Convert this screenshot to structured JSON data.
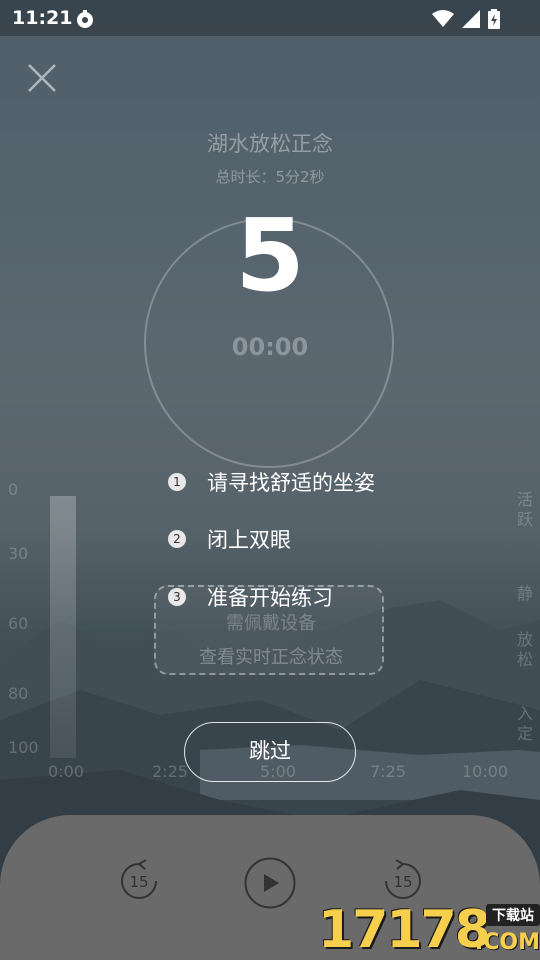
{
  "statusbar": {
    "time": "11:21"
  },
  "header": {
    "title": "湖水放松正念",
    "duration": "总时长：5分2秒"
  },
  "timer": {
    "countdown": "5",
    "elapsed": "00:00"
  },
  "chart_bg": {
    "y_ticks": [
      "0",
      "30",
      "60",
      "80",
      "100"
    ],
    "x_ticks": [
      "0:00",
      "2:25",
      "5:00",
      "7:25",
      "10:00"
    ],
    "right_labels": [
      "活跃",
      "静",
      "放松",
      "入定"
    ]
  },
  "device_prompt": {
    "line1": "需佩戴设备",
    "line2": "查看实时正念状态"
  },
  "steps": [
    {
      "num": "1",
      "text": "请寻找舒适的坐姿"
    },
    {
      "num": "2",
      "text": "闭上双眼"
    },
    {
      "num": "3",
      "text": "准备开始练习"
    }
  ],
  "skip_label": "跳过",
  "controls": {
    "rewind_seconds": "15",
    "forward_seconds": "15"
  },
  "watermark": {
    "number": "17178",
    "tag": "下载站",
    "com": ".COM"
  },
  "colors": {
    "panel": "#6a6a6a",
    "watermark": "#f6d04d"
  }
}
